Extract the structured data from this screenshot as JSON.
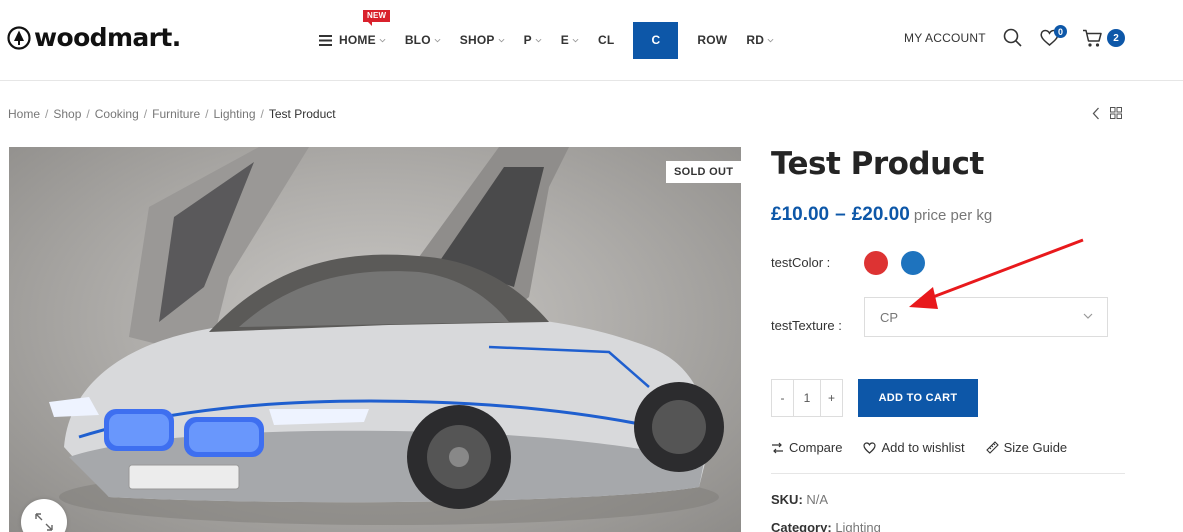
{
  "header": {
    "logo_text": "woodmart.",
    "nav": [
      {
        "label": "HOME",
        "badge": "NEW",
        "has_dropdown": true
      },
      {
        "label": "BLO",
        "has_dropdown": true
      },
      {
        "label": "SHOP",
        "has_dropdown": true
      },
      {
        "label": "P",
        "has_dropdown": true
      },
      {
        "label": "E",
        "has_dropdown": true
      },
      {
        "label": "CL",
        "has_dropdown": false
      },
      {
        "label": "C",
        "has_dropdown": false,
        "highlighted": true
      },
      {
        "label": "ROW",
        "has_dropdown": false
      },
      {
        "label": "RD",
        "has_dropdown": true
      }
    ],
    "my_account": "MY ACCOUNT",
    "wishlist_count": "0",
    "cart_count": "2",
    "icons": [
      "search-icon",
      "heart-icon",
      "cart-icon"
    ]
  },
  "breadcrumb": {
    "items": [
      "Home",
      "Shop",
      "Cooking",
      "Furniture",
      "Lighting"
    ],
    "current": "Test Product"
  },
  "product": {
    "badge": "SOLD OUT",
    "title": "Test Product",
    "price_low": "£10.00",
    "price_sep": "–",
    "price_high": "£20.00",
    "price_suffix": "price per kg",
    "attributes": {
      "color_label": "testColor",
      "color_swatches": [
        "#dd3333",
        "#1e73be"
      ],
      "texture_label": "testTexture",
      "texture_selected": "CP"
    },
    "quantity": "1",
    "qty_minus": "-",
    "qty_plus": "+",
    "add_to_cart": "ADD TO CART",
    "actions": {
      "compare": "Compare",
      "wishlist": "Add to wishlist",
      "size_guide": "Size Guide"
    },
    "meta": {
      "sku_label": "SKU:",
      "sku_value": "N/A",
      "category_label": "Category:",
      "category_value": "Lighting"
    }
  },
  "colors": {
    "accent": "#0d57a8",
    "new_badge": "#d9212c",
    "annotation_arrow": "#e8191c"
  }
}
